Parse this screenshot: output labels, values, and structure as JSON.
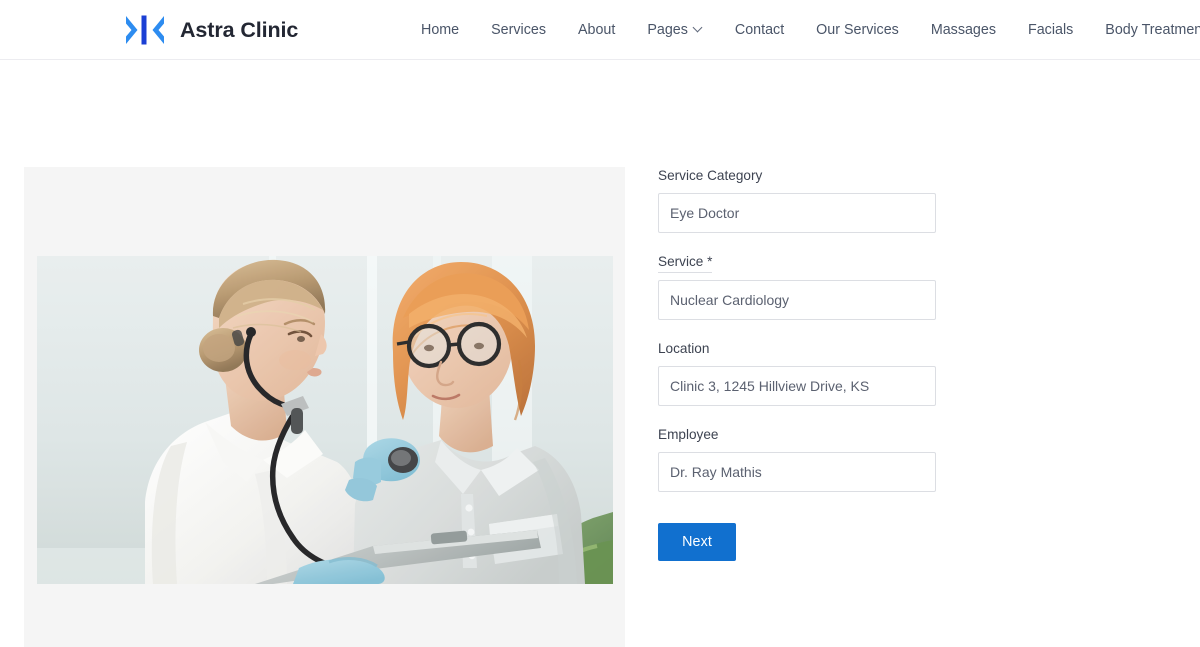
{
  "header": {
    "brand": {
      "name": "Astra Clinic",
      "logo_icon": "double-chevron-logo",
      "logo_color_light": "#2d8cf0",
      "logo_color_dark": "#1b3fd4"
    },
    "nav": [
      {
        "label": "Home",
        "has_dropdown": false
      },
      {
        "label": "Services",
        "has_dropdown": false
      },
      {
        "label": "About",
        "has_dropdown": false
      },
      {
        "label": "Pages",
        "has_dropdown": true
      },
      {
        "label": "Contact",
        "has_dropdown": false
      },
      {
        "label": "Our Services",
        "has_dropdown": false
      },
      {
        "label": "Massages",
        "has_dropdown": false
      },
      {
        "label": "Facials",
        "has_dropdown": false
      },
      {
        "label": "Body Treatments",
        "has_dropdown": false
      }
    ]
  },
  "media": {
    "panel_background": "#f5f5f5",
    "photo_alt": "Doctor in white coat with stethoscope examining a patient holding a clipboard in a bright clinic"
  },
  "booking_form": {
    "fields": [
      {
        "label": "Service Category",
        "required": false,
        "value": "Eye Doctor",
        "placeholder": "Eye Doctor"
      },
      {
        "label": "Service",
        "required": true,
        "required_mark": "*",
        "value": "Nuclear Cardiology",
        "placeholder": "Nuclear Cardiology"
      },
      {
        "label": "Location",
        "required": false,
        "value": "Clinic 3, 1245 Hillview Drive, KS",
        "placeholder": "Clinic 3, 1245 Hillview Drive, KS"
      },
      {
        "label": "Employee",
        "required": false,
        "value": "Dr. Ray Mathis",
        "placeholder": "Dr. Ray Mathis"
      }
    ],
    "submit": {
      "label": "Next",
      "color": "#1170cf"
    }
  }
}
